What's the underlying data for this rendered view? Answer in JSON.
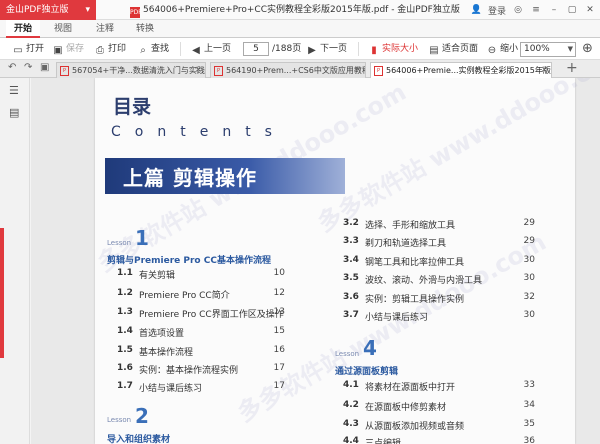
{
  "app": {
    "badge": "金山PDF独立版",
    "window_title": "564006+Premiere+Pro+CC实例教程全彩版2015年版.pdf - 金山PDF独立版",
    "login_label": "登录"
  },
  "menu": {
    "tabs": [
      "开始",
      "视图",
      "注释",
      "转换"
    ]
  },
  "toolbar": {
    "open": "打开",
    "save": "保存",
    "print": "打印",
    "find": "查找",
    "prev": "上一页",
    "page_current": "5",
    "page_total": "/188页",
    "next": "下一页",
    "actual_size": "实际大小",
    "fit_page": "适合页面",
    "zoom_out": "缩小",
    "zoom_value": "100%"
  },
  "doc_tabs": [
    "567054+干净...数据清洗入门与实践",
    "564190+Prem...+CS6中文版应用教程",
    "564006+Premie...实例教程全彩版2015年版"
  ],
  "document": {
    "heading": "目录",
    "contents_word": "Contents",
    "part_title": "上篇 剪辑操作",
    "watermark": "多多软件站 www.ddooo.com",
    "lesson_word": "Lesson",
    "left_lessons": [
      {
        "num": "1",
        "title": "剪辑与Premiere Pro CC基本操作流程",
        "items": [
          {
            "n": "1.1",
            "t": "有关剪辑",
            "p": "10"
          },
          {
            "n": "1.2",
            "t": "Premiere Pro CC简介",
            "p": "12"
          },
          {
            "n": "1.3",
            "t": "Premiere Pro CC界面工作区及操作",
            "p": "13"
          },
          {
            "n": "1.4",
            "t": "首选项设置",
            "p": "15"
          },
          {
            "n": "1.5",
            "t": "基本操作流程",
            "p": "16"
          },
          {
            "n": "1.6",
            "t": "实例：基本操作流程实例",
            "p": "17"
          },
          {
            "n": "1.7",
            "t": "小结与课后练习",
            "p": "17"
          }
        ]
      },
      {
        "num": "2",
        "title": "导入和组织素材"
      }
    ],
    "right_items": [
      {
        "n": "3.2",
        "t": "选择、手形和缩放工具",
        "p": "29"
      },
      {
        "n": "3.3",
        "t": "剃刀和轨道选择工具",
        "p": "29"
      },
      {
        "n": "3.4",
        "t": "钢笔工具和比率拉伸工具",
        "p": "30"
      },
      {
        "n": "3.5",
        "t": "波纹、滚动、外滑与内滑工具",
        "p": "30"
      },
      {
        "n": "3.6",
        "t": "实例：剪辑工具操作实例",
        "p": "32"
      },
      {
        "n": "3.7",
        "t": "小结与课后练习",
        "p": "30"
      }
    ],
    "right_lesson": {
      "num": "4",
      "title": "通过源面板剪辑",
      "items": [
        {
          "n": "4.1",
          "t": "将素材在源面板中打开",
          "p": "33"
        },
        {
          "n": "4.2",
          "t": "在源面板中修剪素材",
          "p": "34"
        },
        {
          "n": "4.3",
          "t": "从源面板添加视频或音频",
          "p": "35"
        },
        {
          "n": "4.4",
          "t": "三点编辑",
          "p": "36"
        }
      ]
    }
  },
  "colors": {
    "accent": "#e0393e",
    "heading_blue": "#2c3e6e",
    "lesson_blue": "#3a6fb8"
  }
}
